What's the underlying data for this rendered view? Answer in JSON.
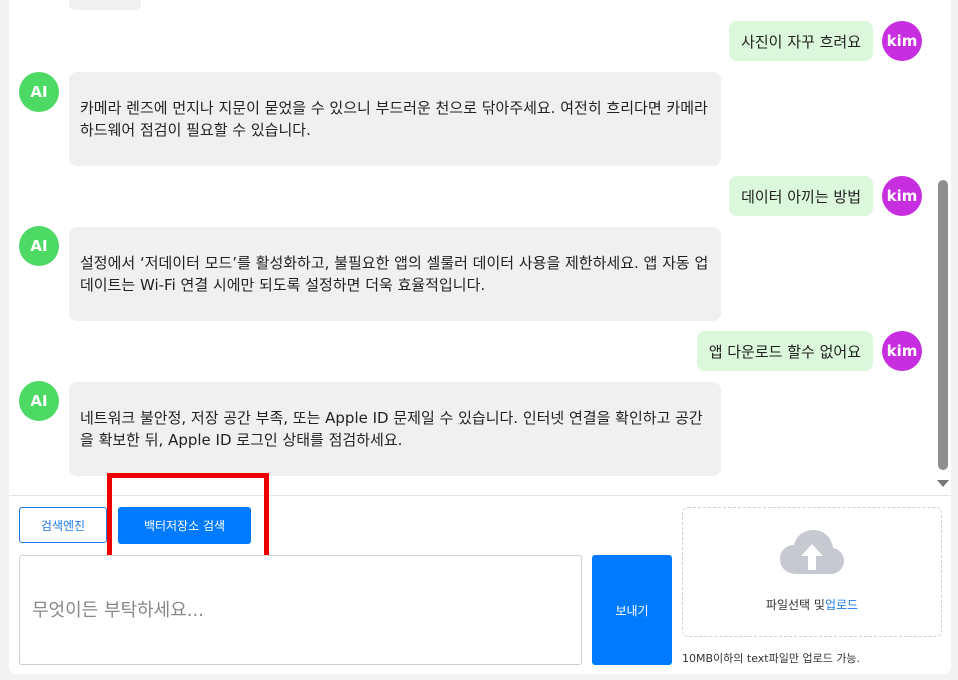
{
  "chat": {
    "messages": [
      {
        "role": "user",
        "avatar": "kim",
        "text": "사진이 자꾸 흐려요"
      },
      {
        "role": "ai",
        "avatar": "AI",
        "text": "카메라 렌즈에 먼지나 지문이 묻었을 수 있으니 부드러운 천으로 닦아주세요. 여전히 흐리다면 카메라 하드웨어 점검이 필요할 수 있습니다."
      },
      {
        "role": "user",
        "avatar": "kim",
        "text": "데이터 아끼는 방법"
      },
      {
        "role": "ai",
        "avatar": "AI",
        "text": "설정에서 ‘저데이터 모드’를 활성화하고, 불필요한 앱의 셀룰러 데이터 사용을 제한하세요. 앱 자동 업데이트는 Wi-Fi 연결 시에만 되도록 설정하면 더욱 효율적입니다."
      },
      {
        "role": "user",
        "avatar": "kim",
        "text": "앱 다운로드 할수 없어요"
      },
      {
        "role": "ai",
        "avatar": "AI",
        "text": "네트워크 불안정, 저장 공간 부족, 또는 Apple ID 문제일 수 있습니다. 인터넷 연결을 확인하고 공간을 확보한 뒤, Apple ID 로그인 상태를 점검하세요."
      }
    ]
  },
  "controls": {
    "search_engine_label": "검색엔진",
    "vector_store_label": "백터저장소 검색",
    "prompt_placeholder": "무엇이든 부탁하세요...",
    "send_label": "보내기"
  },
  "upload": {
    "label_prefix": "파일선택 및",
    "label_link": "업로드",
    "note": "10MB이하의 text파일만 업로드 가능."
  },
  "colors": {
    "ai_avatar": "#4cd964",
    "user_avatar": "#c72ee0",
    "user_bubble": "#dcf8dc",
    "ai_bubble": "#f0f0f0",
    "primary": "#007bff",
    "highlight": "#ee0000"
  }
}
